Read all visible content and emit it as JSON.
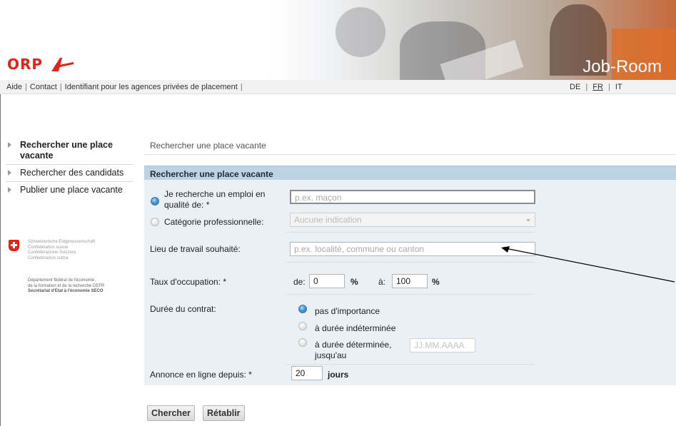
{
  "header": {
    "logo_text": "ORP",
    "app_title": "Job-Room"
  },
  "topnav": {
    "links": [
      "Aide",
      "Contact",
      "Identifiant pour les agences privées de placement"
    ],
    "languages": [
      "DE",
      "FR",
      "IT"
    ],
    "active_language": "FR"
  },
  "sidebar": {
    "items": [
      {
        "label": "Rechercher une place vacante",
        "active": true
      },
      {
        "label": "Rechercher des candidats",
        "active": false
      },
      {
        "label": "Publier une place vacante",
        "active": false
      }
    ],
    "confederation_lines": [
      "Schweizerische Eidgenossenschaft",
      "Confédération suisse",
      "Confederazione Svizzera",
      "Confederaziun svizra"
    ],
    "department_lines": [
      "Département fédéral de l'économie,",
      "de la formation et de la recherche DEFR",
      "Secrétariat d'Etat à l'économie SECO"
    ]
  },
  "breadcrumb": "Rechercher une place vacante",
  "form": {
    "title": "Rechercher une place vacante",
    "search_by": {
      "option_job_label": "Je recherche un emploi en qualité de: *",
      "job_placeholder": "p.ex. maçon",
      "option_category_label": "Catégorie professionnelle:",
      "category_selected": "Aucune indication",
      "selected": "job"
    },
    "location": {
      "label": "Lieu de travail souhaité:",
      "placeholder": "p.ex. localité, commune ou canton"
    },
    "occupancy": {
      "label": "Taux d'occupation: *",
      "from_label": "de:",
      "from_value": "0",
      "to_label": "à:",
      "to_value": "100",
      "unit": "%"
    },
    "contract": {
      "label": "Durée du contrat:",
      "options": [
        "pas d'importance",
        "à durée indéterminée",
        "à durée déterminée, jusqu'au"
      ],
      "selected": "pas d'importance",
      "date_placeholder": "JJ.MM.AAAA"
    },
    "online_since": {
      "label": "Annonce en ligne depuis: *",
      "value": "20",
      "unit": "jours"
    }
  },
  "buttons": {
    "search": "Chercher",
    "reset": "Rétablir"
  },
  "colors": {
    "brand_red": "#e2231a",
    "panel_header": "#bcd3e4",
    "panel_bg": "#e9f0f6"
  }
}
